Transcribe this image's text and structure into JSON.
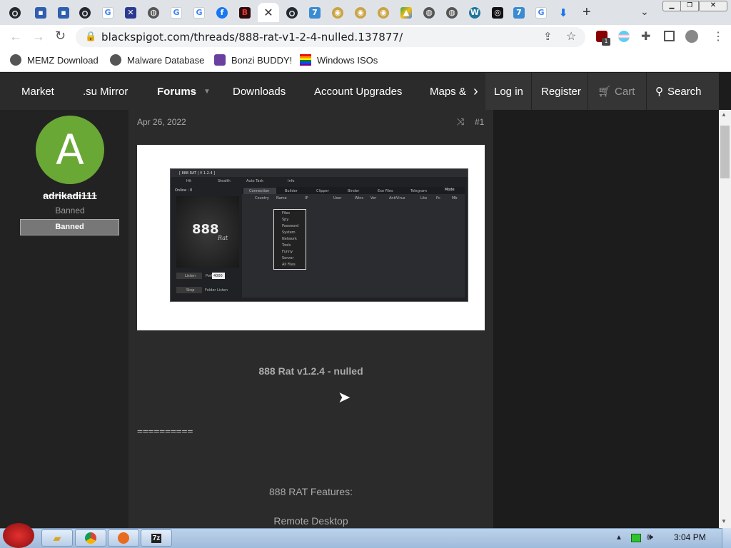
{
  "browser": {
    "url": "blackspigot.com/threads/888-rat-v1-2-4-nulled.137877/",
    "bookmarks": [
      {
        "label": "MEMZ Download",
        "icon": "globe-icon"
      },
      {
        "label": "Malware Database",
        "icon": "globe-icon"
      },
      {
        "label": "Bonzi BUDDY!",
        "icon": "bonzi-icon"
      },
      {
        "label": "Windows ISOs",
        "icon": "rainbow-flag-icon"
      }
    ],
    "shield_badge": "1",
    "colors": {
      "tabstrip": "#dfe3e8",
      "accent": "#1a73e8"
    }
  },
  "site_nav": {
    "items": [
      "Market",
      ".su Mirror",
      "Forums",
      "Downloads",
      "Account Upgrades",
      "Maps &"
    ],
    "login": "Log in",
    "register": "Register",
    "cart": "Cart",
    "search": "Search"
  },
  "post": {
    "avatar_letter": "A",
    "username": "adrikadi111",
    "user_title": "Banned",
    "banner": "Banned",
    "date": "Apr 26, 2022",
    "post_number": "#1",
    "title": "888 Rat v1.2.4 - nulled",
    "separator": "==========",
    "features_heading": "888 RAT Features:",
    "feature_1": "Remote Desktop"
  },
  "screenshot_image": {
    "window_title": "[ 888 RAT | V 1.2.4 ]",
    "menu": [
      "Hit",
      "Stealth",
      "Auto Task",
      "Info"
    ],
    "online": "Online : 0",
    "logo": "888",
    "logo_sub": "Rat",
    "tabs": [
      "Connection",
      "Builder",
      "Clipper",
      "Binder",
      "Exe Files",
      "Telegram"
    ],
    "mode": "Mode",
    "columns": [
      "Country",
      "Name",
      "IP",
      "User",
      "Wins",
      "Ver",
      "AntiVirus",
      "Lite",
      "Pc",
      "Mb"
    ],
    "context_menu": [
      "Files",
      "Spy",
      "Password",
      "System",
      "Network",
      "Tools",
      "Funny",
      "Server",
      "All Files"
    ],
    "listen_label": "Listen",
    "port_label": "Port :",
    "port_value": "4000",
    "stop_label": "Stop",
    "folder_label": "Folder Listen"
  },
  "taskbar": {
    "time": "3:04 PM"
  }
}
